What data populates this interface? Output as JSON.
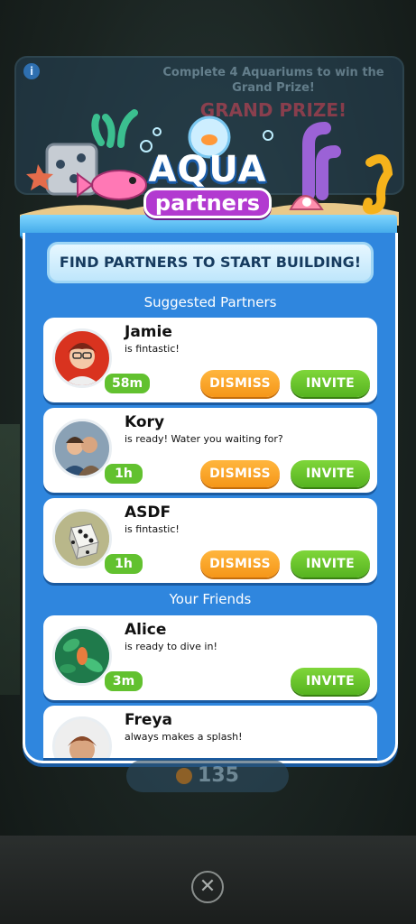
{
  "background": {
    "banner_text": "Complete 4 Aquariums to win the Grand Prize!",
    "banner_grand": "GRAND PRIZE!",
    "info_icon_label": "i",
    "coins": "135"
  },
  "header": {
    "logo_top": "AQUA",
    "logo_bottom": "partners"
  },
  "panel": {
    "find_button": "FIND PARTNERS TO START BUILDING!",
    "suggested_label": "Suggested Partners",
    "friends_label": "Your Friends"
  },
  "suggested": [
    {
      "name": "Jamie",
      "status": "is fintastic!",
      "timer": "58m",
      "dismiss": "DISMISS",
      "invite": "INVITE"
    },
    {
      "name": "Kory",
      "status": "is ready! Water you waiting for?",
      "timer": "1h",
      "dismiss": "DISMISS",
      "invite": "INVITE"
    },
    {
      "name": "ASDF",
      "status": "is fintastic!",
      "timer": "1h",
      "dismiss": "DISMISS",
      "invite": "INVITE"
    }
  ],
  "friends": [
    {
      "name": "Alice",
      "status": "is ready to dive in!",
      "timer": "3m",
      "invite": "INVITE"
    },
    {
      "name": "Freya",
      "status": "always makes a splash!"
    }
  ],
  "close_symbol": "✕",
  "colors": {
    "panel_blue": "#2f86de",
    "invite_green": "#56b320",
    "dismiss_orange": "#f59618",
    "timer_green": "#62c12f"
  }
}
